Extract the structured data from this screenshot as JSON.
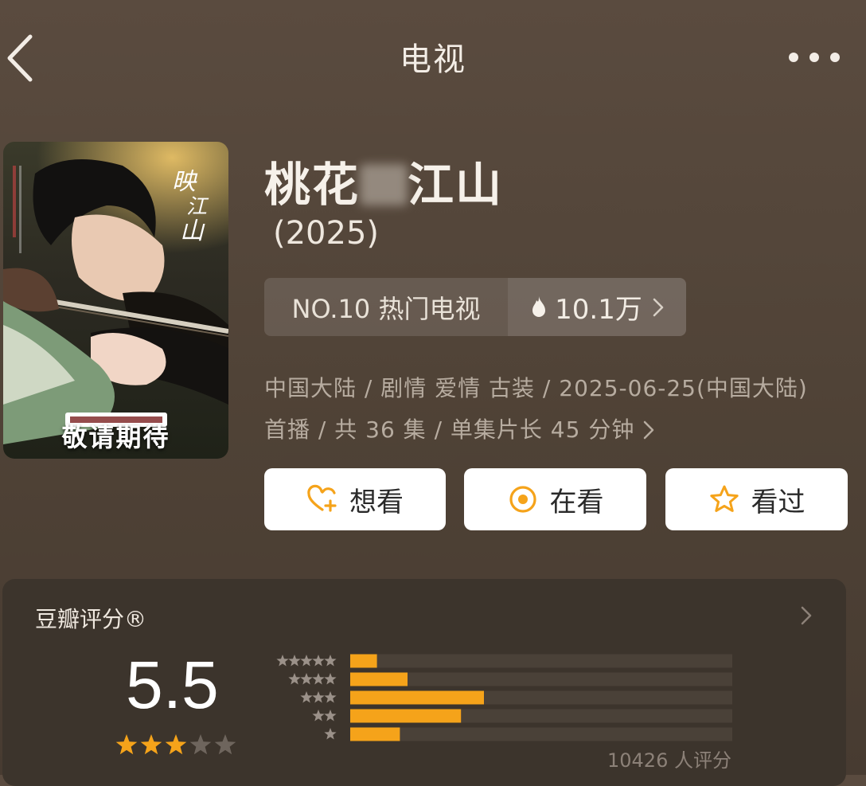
{
  "nav": {
    "title": "电视",
    "back_icon": "chevron-left-icon",
    "more_icon": "more-horizontal-icon"
  },
  "poster": {
    "cta": "敬请期待"
  },
  "show": {
    "title_before": "桃花",
    "title_after": "江山",
    "year": "(2025)"
  },
  "rank": {
    "label": "NO.10 热门电视",
    "heat": "10.1万"
  },
  "meta": {
    "line1": "中国大陆 / 剧情 爱情 古装 / 2025-06-25(中国大陆)",
    "line2": "首播 / 共 36 集 / 单集片长 45 分钟"
  },
  "actions": [
    {
      "label": "想看",
      "icon": "heart-plus-icon"
    },
    {
      "label": "在看",
      "icon": "target-icon"
    },
    {
      "label": "看过",
      "icon": "star-outline-icon"
    }
  ],
  "rating": {
    "label": "豆瓣评分®",
    "score": "5.5",
    "stars_filled": 3,
    "stars_total": 5,
    "count_text": "10426 人评分",
    "distribution": [
      {
        "stars": 5,
        "fraction": 0.07
      },
      {
        "stars": 4,
        "fraction": 0.15
      },
      {
        "stars": 3,
        "fraction": 0.35
      },
      {
        "stars": 2,
        "fraction": 0.29
      },
      {
        "stars": 1,
        "fraction": 0.13
      }
    ]
  },
  "colors": {
    "accent_orange": "#f5a31a",
    "star_gray": "#6e655d",
    "bar_track": "#4a4138"
  }
}
